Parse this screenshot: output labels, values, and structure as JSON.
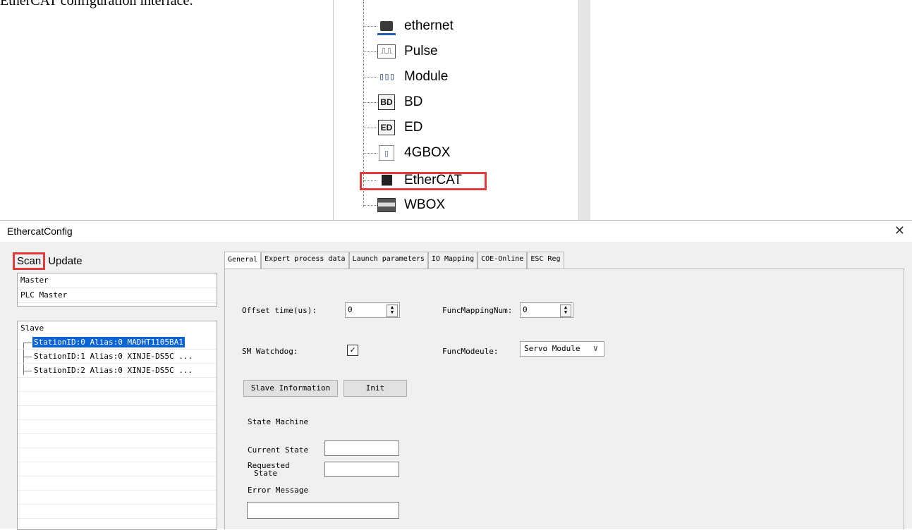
{
  "intro_text": "EtherCAT configuration interface:",
  "tree": {
    "items": [
      {
        "label": "ethernet",
        "icon": "ethernet-icon"
      },
      {
        "label": "Pulse",
        "icon": "pulse-icon"
      },
      {
        "label": "Module",
        "icon": "module-icon"
      },
      {
        "label": "BD",
        "icon": "bd-icon"
      },
      {
        "label": "ED",
        "icon": "ed-icon"
      },
      {
        "label": "4GBOX",
        "icon": "4gbox-icon"
      },
      {
        "label": "EtherCAT",
        "icon": "ethercat-icon"
      },
      {
        "label": "WBOX",
        "icon": "wbox-icon"
      }
    ],
    "icon_text": {
      "pulse": "⎍⎍",
      "module": "▯▯▯",
      "bd": "BD",
      "ed": "ED",
      "g4": "▯",
      "ethercat": "██"
    }
  },
  "window": {
    "title": "EthercatConfig",
    "close": "✕"
  },
  "toolbar": {
    "scan": "Scan",
    "update": "Update"
  },
  "master": {
    "header": "Master",
    "item": "PLC Master"
  },
  "slave": {
    "header": "Slave",
    "rows": [
      "StationID:0  Alias:0  MADHT1105BA1",
      "StationID:1  Alias:0  XINJE-DS5C ...",
      "StationID:2  Alias:0  XINJE-DS5C ..."
    ]
  },
  "tabs": [
    "General",
    "Expert process data",
    "Launch parameters",
    "IO Mapping",
    "COE-Online",
    "ESC Reg"
  ],
  "general": {
    "offset_label": "Offset time(us):",
    "offset_value": "0",
    "funcmapping_label": "FuncMappingNum:",
    "funcmapping_value": "0",
    "watchdog_label": "SM Watchdog:",
    "watchdog_mark": "✓",
    "funcmodule_label": "FuncModeule:",
    "funcmodule_value": "Servo Module",
    "slave_info_btn": "Slave Information",
    "init_btn": "Init",
    "state_machine": "State Machine",
    "current_state": "Current State",
    "requested_state_1": "Requested",
    "requested_state_2": "State",
    "error_message": "Error Message",
    "spin_arrows": "▲\n▼",
    "chevron": "∨"
  },
  "colors": {
    "highlight": "#e23b3b",
    "selection": "#0a64d6"
  }
}
